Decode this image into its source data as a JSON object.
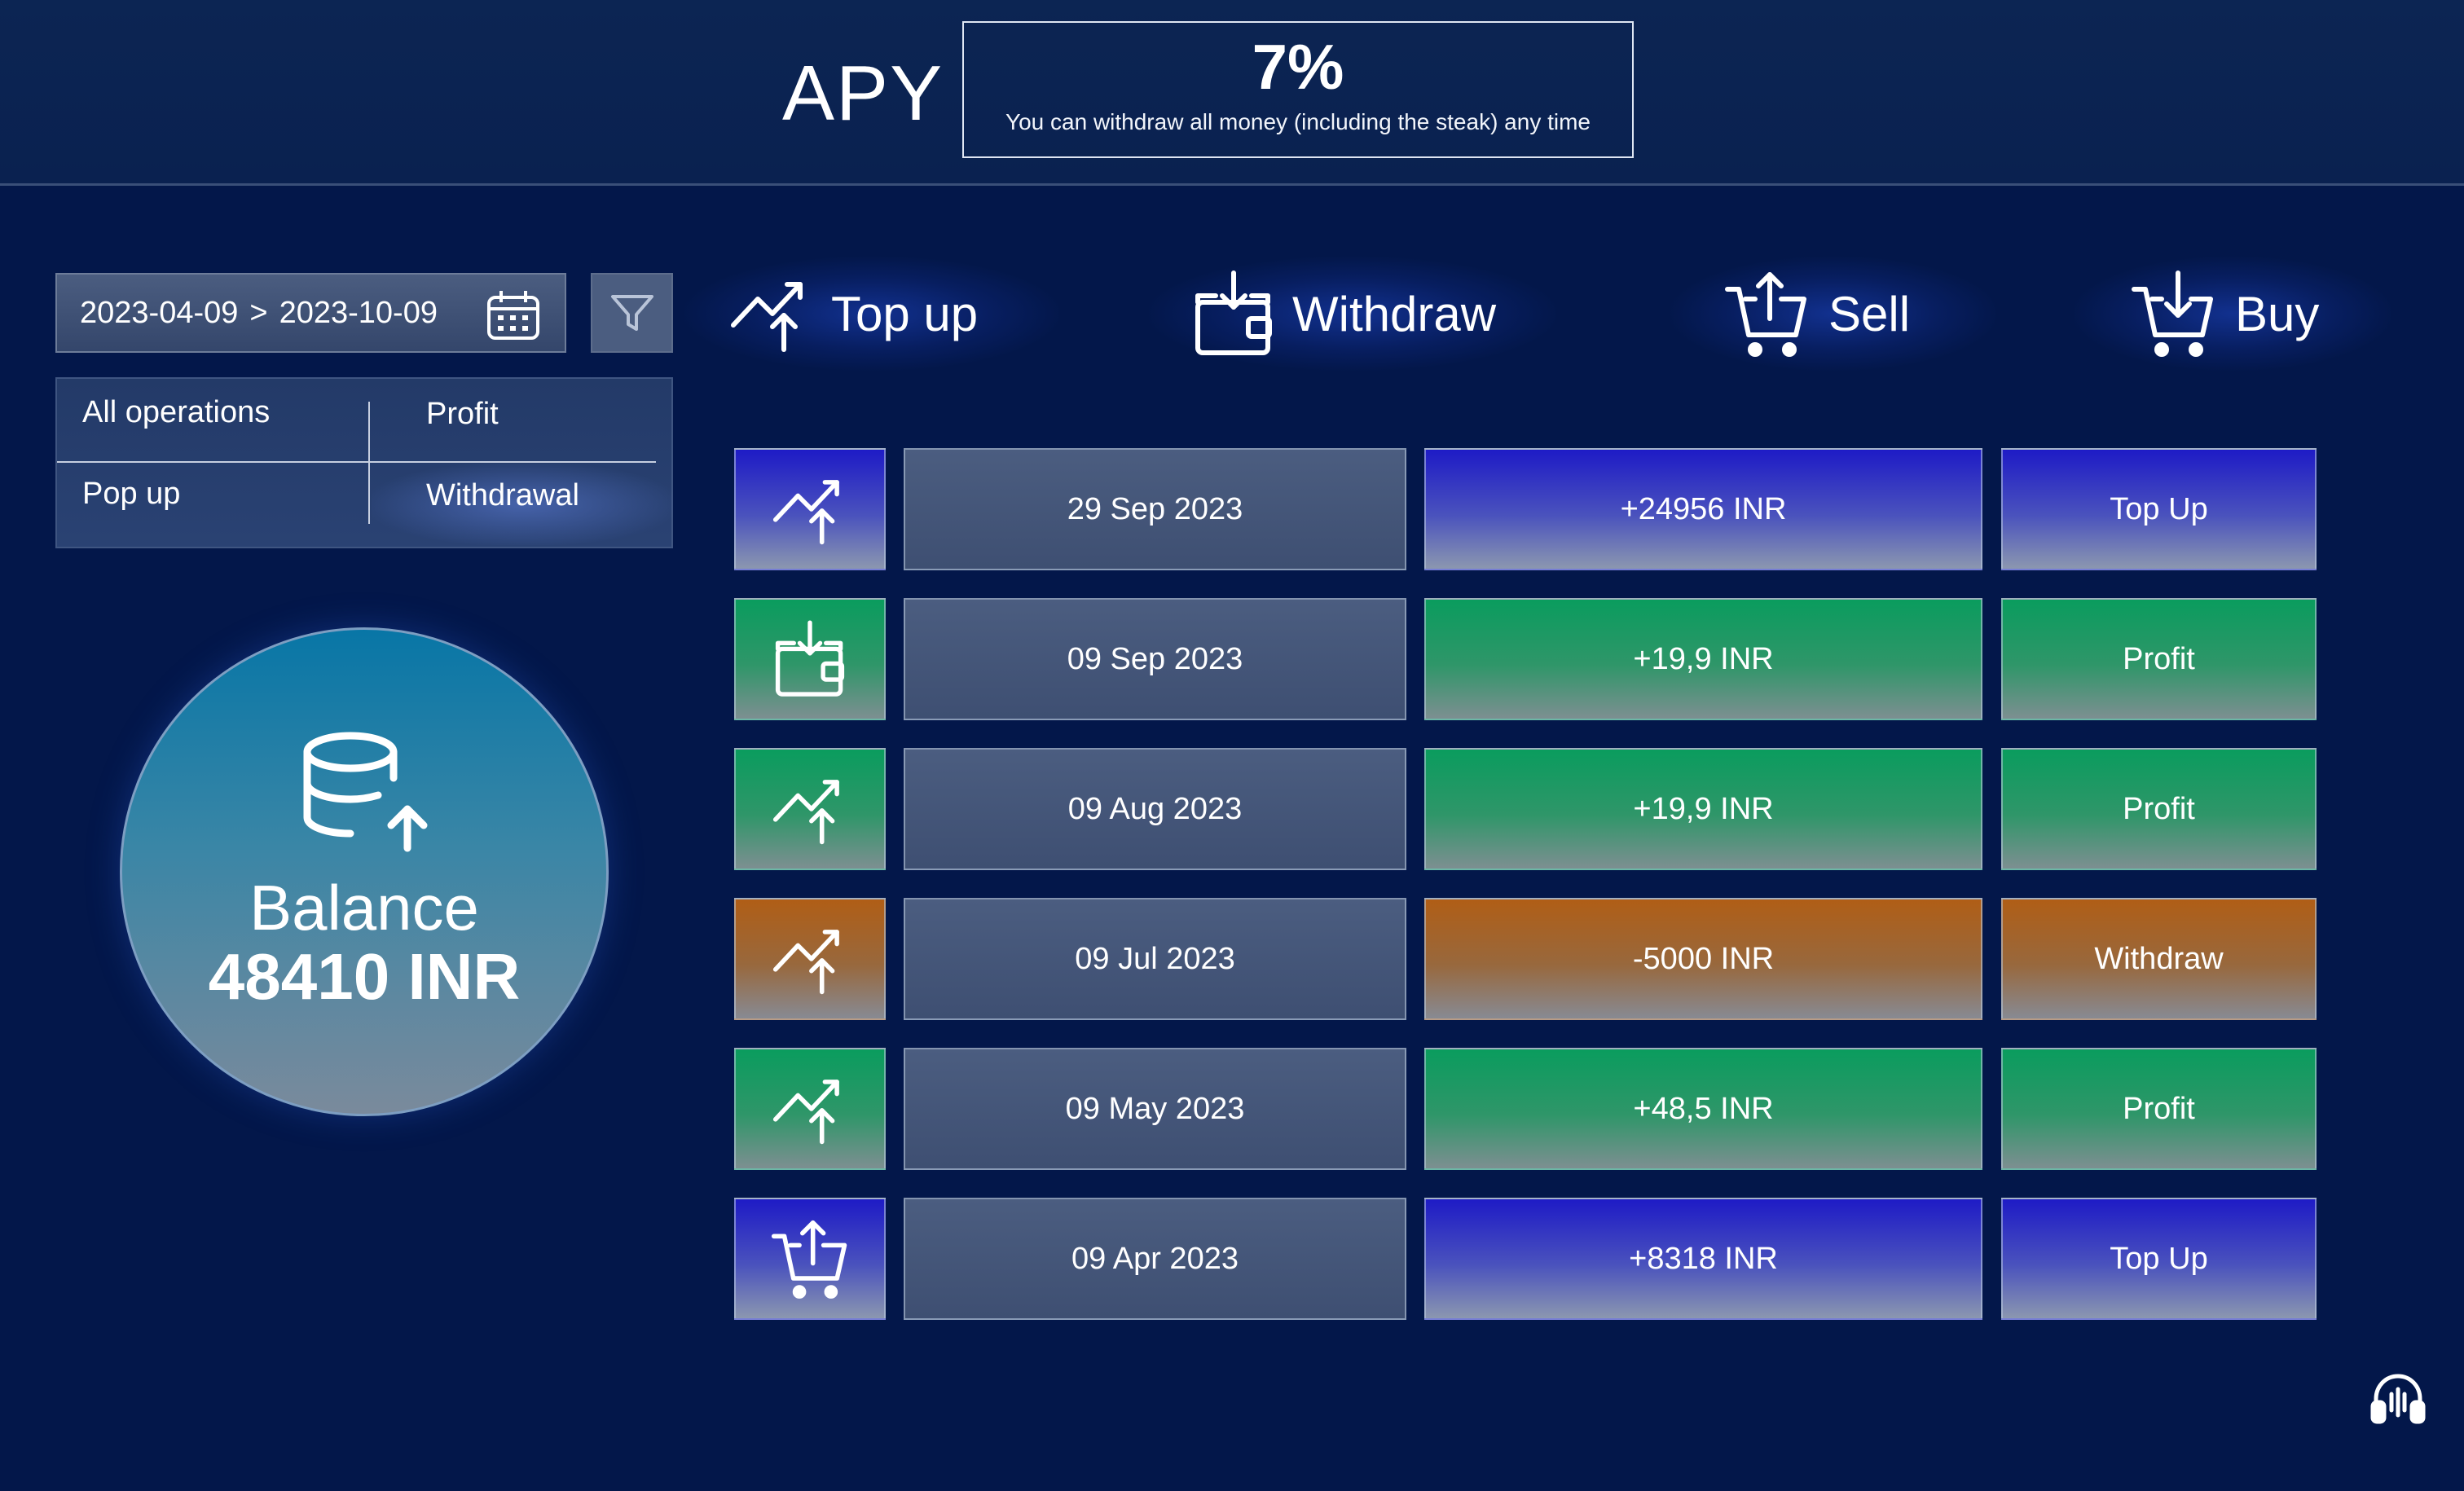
{
  "header": {
    "apy_label": "APY",
    "apy_value": "7%",
    "apy_note": "You can withdraw all money (including the steak) any time"
  },
  "date_range": {
    "start": "2023-04-09",
    "separator": ">",
    "end": "2023-10-09",
    "icon": "calendar-icon"
  },
  "filter_button": {
    "icon": "funnel-icon"
  },
  "operations_filter": {
    "options": [
      "All operations",
      "Profit",
      "Pop up",
      "Withdrawal"
    ],
    "selected": "Withdrawal"
  },
  "balance": {
    "label": "Balance",
    "value": "48410 INR",
    "icon": "database-upload-icon"
  },
  "actions": [
    {
      "label": "Top up",
      "icon": "trend-up-arrow-icon"
    },
    {
      "label": "Withdraw",
      "icon": "wallet-download-icon"
    },
    {
      "label": "Sell",
      "icon": "cart-upload-icon"
    },
    {
      "label": "Buy",
      "icon": "cart-download-icon"
    }
  ],
  "transactions": [
    {
      "icon": "trend-up-arrow-icon",
      "date": "29 Sep 2023",
      "amount": "+24956 INR",
      "type": "Top Up",
      "color": "#1e1bc6"
    },
    {
      "icon": "wallet-download-icon",
      "date": "09 Sep 2023",
      "amount": "+19,9 INR",
      "type": "Profit",
      "color": "#0a9c5e"
    },
    {
      "icon": "trend-up-arrow-icon",
      "date": "09 Aug 2023",
      "amount": "+19,9 INR",
      "type": "Profit",
      "color": "#0a9c5e"
    },
    {
      "icon": "trend-up-arrow-icon",
      "date": "09 Jul 2023",
      "amount": "-5000 INR",
      "type": "Withdraw",
      "color": "#b05e16"
    },
    {
      "icon": "trend-up-arrow-icon",
      "date": "09 May 2023",
      "amount": "+48,5 INR",
      "type": "Profit",
      "color": "#0a9c5e"
    },
    {
      "icon": "cart-upload-icon",
      "date": "09 Apr 2023",
      "amount": "+8318 INR",
      "type": "Top Up",
      "color": "#1e1bc6"
    }
  ],
  "support": {
    "icon": "headphones-icon"
  },
  "colors": {
    "background": "#03174a",
    "top_up": "#1e1bc6",
    "profit": "#0a9c5e",
    "withdraw": "#b05e16"
  }
}
